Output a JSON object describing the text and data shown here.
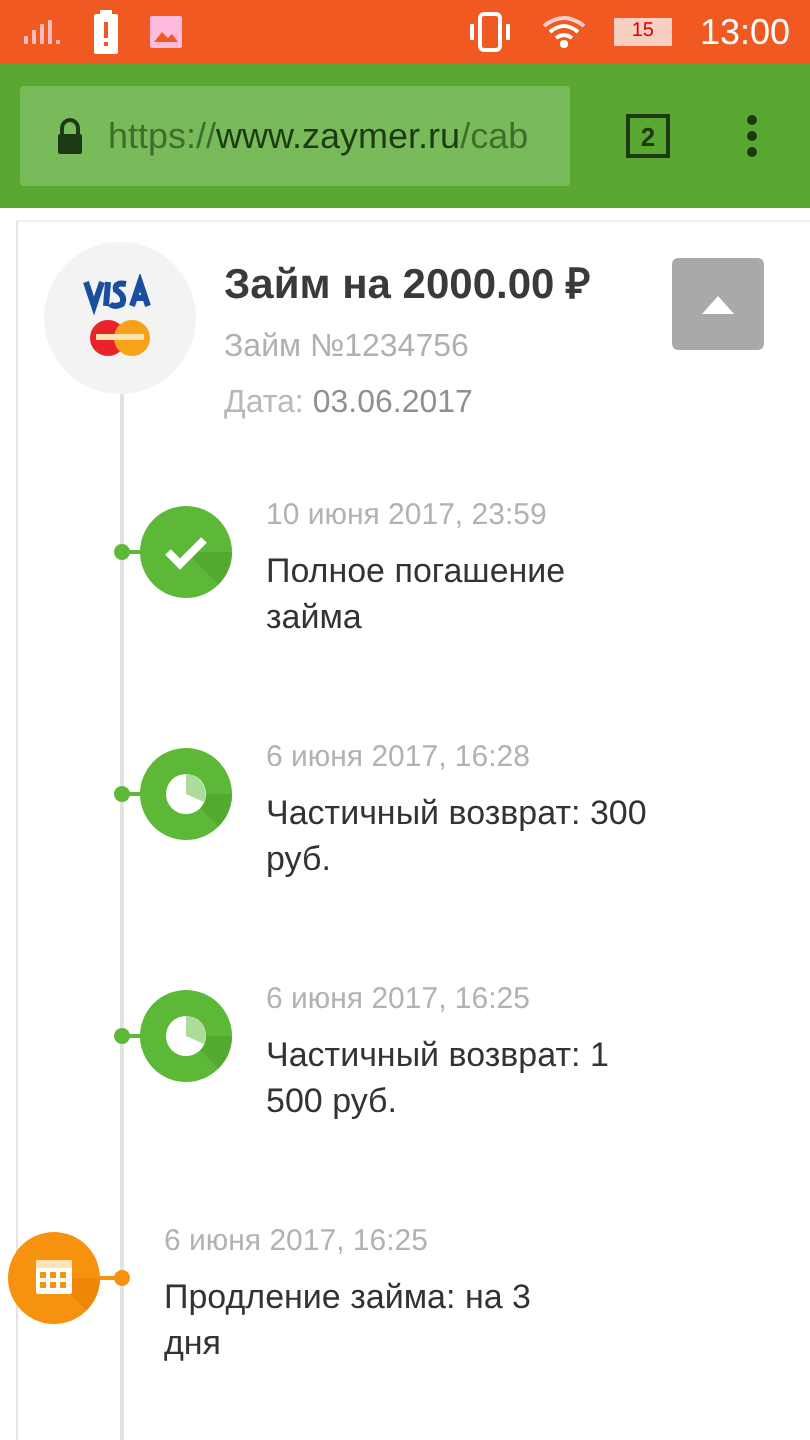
{
  "status_bar": {
    "battery_level_text": "15",
    "time": "13:00"
  },
  "browser": {
    "url_scheme": "https://",
    "url_host": "www.zaymer.ru",
    "url_path": "/cab",
    "tab_count": "2"
  },
  "loan": {
    "title": "Займ на 2000.00 ₽",
    "number": "Займ №1234756",
    "date_label": "Дата:",
    "date_value": "03.06.2017"
  },
  "events": [
    {
      "kind": "repaid",
      "date": "10 июня 2017, 23:59",
      "title": "Полное погашение займа"
    },
    {
      "kind": "partial",
      "date": "6 июня 2017, 16:28",
      "title": "Частичный возврат: 300 руб."
    },
    {
      "kind": "partial",
      "date": "6 июня 2017, 16:25",
      "title": "Частичный возврат: 1 500 руб."
    },
    {
      "kind": "extension",
      "date": "6 июня 2017, 16:25",
      "title": "Продление займа: на 3 дня"
    }
  ]
}
